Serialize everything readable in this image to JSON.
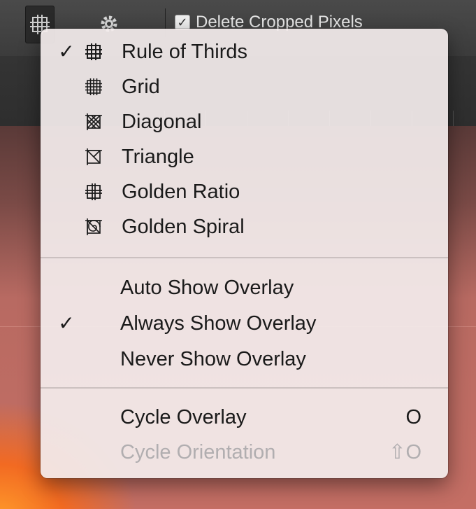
{
  "toolbar": {
    "overlay_button_icon": "grid-overlay-icon",
    "settings_icon": "gear-icon",
    "delete_cropped_label": "Delete Cropped Pixels",
    "delete_cropped_checked": true
  },
  "menu": {
    "overlay_types": [
      {
        "label": "Rule of Thirds",
        "icon": "rule-of-thirds-icon",
        "checked": true
      },
      {
        "label": "Grid",
        "icon": "grid-icon",
        "checked": false
      },
      {
        "label": "Diagonal",
        "icon": "diagonal-icon",
        "checked": false
      },
      {
        "label": "Triangle",
        "icon": "triangle-icon",
        "checked": false
      },
      {
        "label": "Golden Ratio",
        "icon": "golden-ratio-icon",
        "checked": false
      },
      {
        "label": "Golden Spiral",
        "icon": "golden-spiral-icon",
        "checked": false
      }
    ],
    "show_modes": [
      {
        "label": "Auto Show Overlay",
        "checked": false
      },
      {
        "label": "Always Show Overlay",
        "checked": true
      },
      {
        "label": "Never Show Overlay",
        "checked": false
      }
    ],
    "actions": [
      {
        "label": "Cycle Overlay",
        "shortcut": "O",
        "enabled": true
      },
      {
        "label": "Cycle Orientation",
        "shortcut": "⇧O",
        "enabled": false
      }
    ],
    "checkmark": "✓"
  },
  "colors": {
    "menu_background": "#f3ecec",
    "menu_text": "#1a1a1a",
    "disabled_text": "#b1aeb0",
    "canvas_orange": "#f26a22"
  }
}
